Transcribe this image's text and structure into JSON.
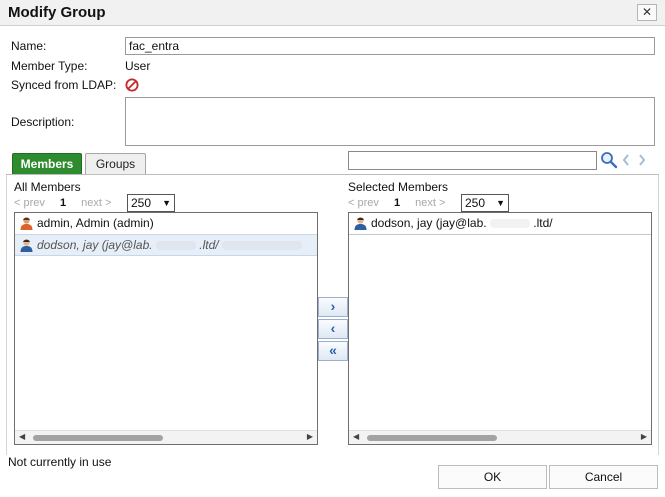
{
  "dialog": {
    "title": "Modify Group",
    "close_glyph": "✕"
  },
  "form": {
    "name_label": "Name:",
    "name_value": "fac_entra",
    "member_type_label": "Member Type:",
    "member_type_value": "User",
    "synced_label": "Synced from LDAP:",
    "synced_icon": "no-entry-icon",
    "description_label": "Description:",
    "description_value": ""
  },
  "tabs": [
    {
      "label": "Members",
      "active": true
    },
    {
      "label": "Groups",
      "active": false
    }
  ],
  "search": {
    "value": "",
    "icons": [
      "search-icon",
      "prev-arrow-icon",
      "next-arrow-icon"
    ]
  },
  "all_members": {
    "heading": "All Members",
    "pager": {
      "prev": "< prev",
      "page": "1",
      "next": "next >"
    },
    "page_size": "250",
    "rows": [
      {
        "text": "admin, Admin (admin)",
        "selected": false
      },
      {
        "text": "dodson, jay (jay@lab.",
        "text_tail": ".ltd/",
        "selected": true
      }
    ]
  },
  "selected_members": {
    "heading": "Selected Members",
    "pager": {
      "prev": "< prev",
      "page": "1",
      "next": "next >"
    },
    "page_size": "250",
    "rows": [
      {
        "text": "dodson, jay (jay@lab.",
        "text_tail": ".ltd/",
        "text_end": ")",
        "selected": false
      }
    ]
  },
  "move_buttons": {
    "add": "›",
    "remove": "‹",
    "remove_all": "«"
  },
  "footer": {
    "status": "Not currently in use",
    "ok_label": "OK",
    "cancel_label": "Cancel"
  },
  "colors": {
    "tab_active": "#2e8b2e",
    "button_arrow": "#2a5fb0",
    "no_entry": "#c62828"
  }
}
